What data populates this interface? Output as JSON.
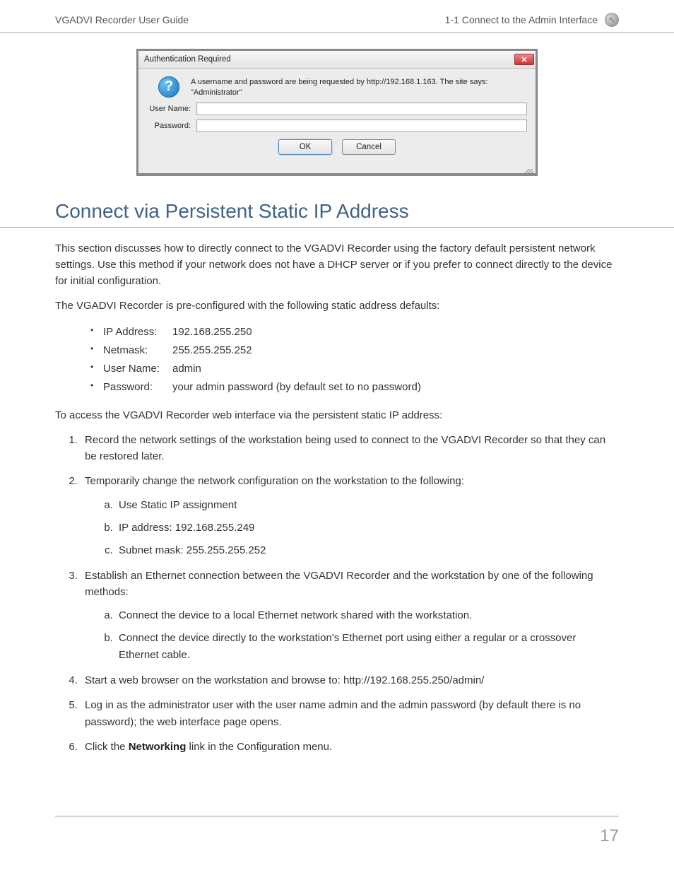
{
  "header": {
    "guide_title": "VGADVI Recorder User Guide",
    "chapter": "1-1  Connect to the Admin Interface"
  },
  "dialog": {
    "title": "Authentication Required",
    "message_line1": "A username and password are being requested by http://192.168.1.163. The site says:",
    "message_line2": "\"Administrator\"",
    "user_label": "User Name:",
    "pass_label": "Password:",
    "ok": "OK",
    "cancel": "Cancel",
    "close_glyph": "✕"
  },
  "section_title": "Connect via Persistent Static IP Address",
  "p1": "This section discusses how to directly connect to the VGADVI Recorder using the factory default persistent network settings. Use this method if your network does not have a DHCP server or if you prefer to connect directly to the device for initial configuration.",
  "p2": "The VGADVI Recorder is pre-configured with the following static address defaults:",
  "defaults": {
    "ip_label": "IP Address:",
    "ip_value": "192.168.255.250",
    "netmask_label": "Netmask:",
    "netmask_value": "255.255.255.252",
    "user_label": "User Name:",
    "user_value": "admin",
    "pass_label": "Password:",
    "pass_value": "your admin password (by default set to no password)"
  },
  "p3": "To access the VGADVI Recorder web interface via the persistent static IP address:",
  "steps": {
    "s1": "Record the network settings of the workstation being used to connect to the VGADVI Recorder so that they can be restored later.",
    "s2": "Temporarily change the network configuration on the workstation to the following:",
    "s2a": "Use Static IP assignment",
    "s2b": "IP address: 192.168.255.249",
    "s2c": "Subnet mask: 255.255.255.252",
    "s3": "Establish an Ethernet connection between the VGADVI Recorder and the workstation by one of the following methods:",
    "s3a": "Connect the device to a local Ethernet network shared with the workstation.",
    "s3b": "Connect the device directly to the workstation's Ethernet port using either a regular or a crossover Ethernet cable.",
    "s4": "Start a web browser on the workstation and browse to: http://192.168.255.250/admin/",
    "s5": "Log in as the administrator user with the user name admin and the admin password (by default there is no password); the web interface page opens.",
    "s6_pre": "Click the ",
    "s6_bold": "Networking",
    "s6_post": " link in the Configuration menu."
  },
  "page_number": "17"
}
